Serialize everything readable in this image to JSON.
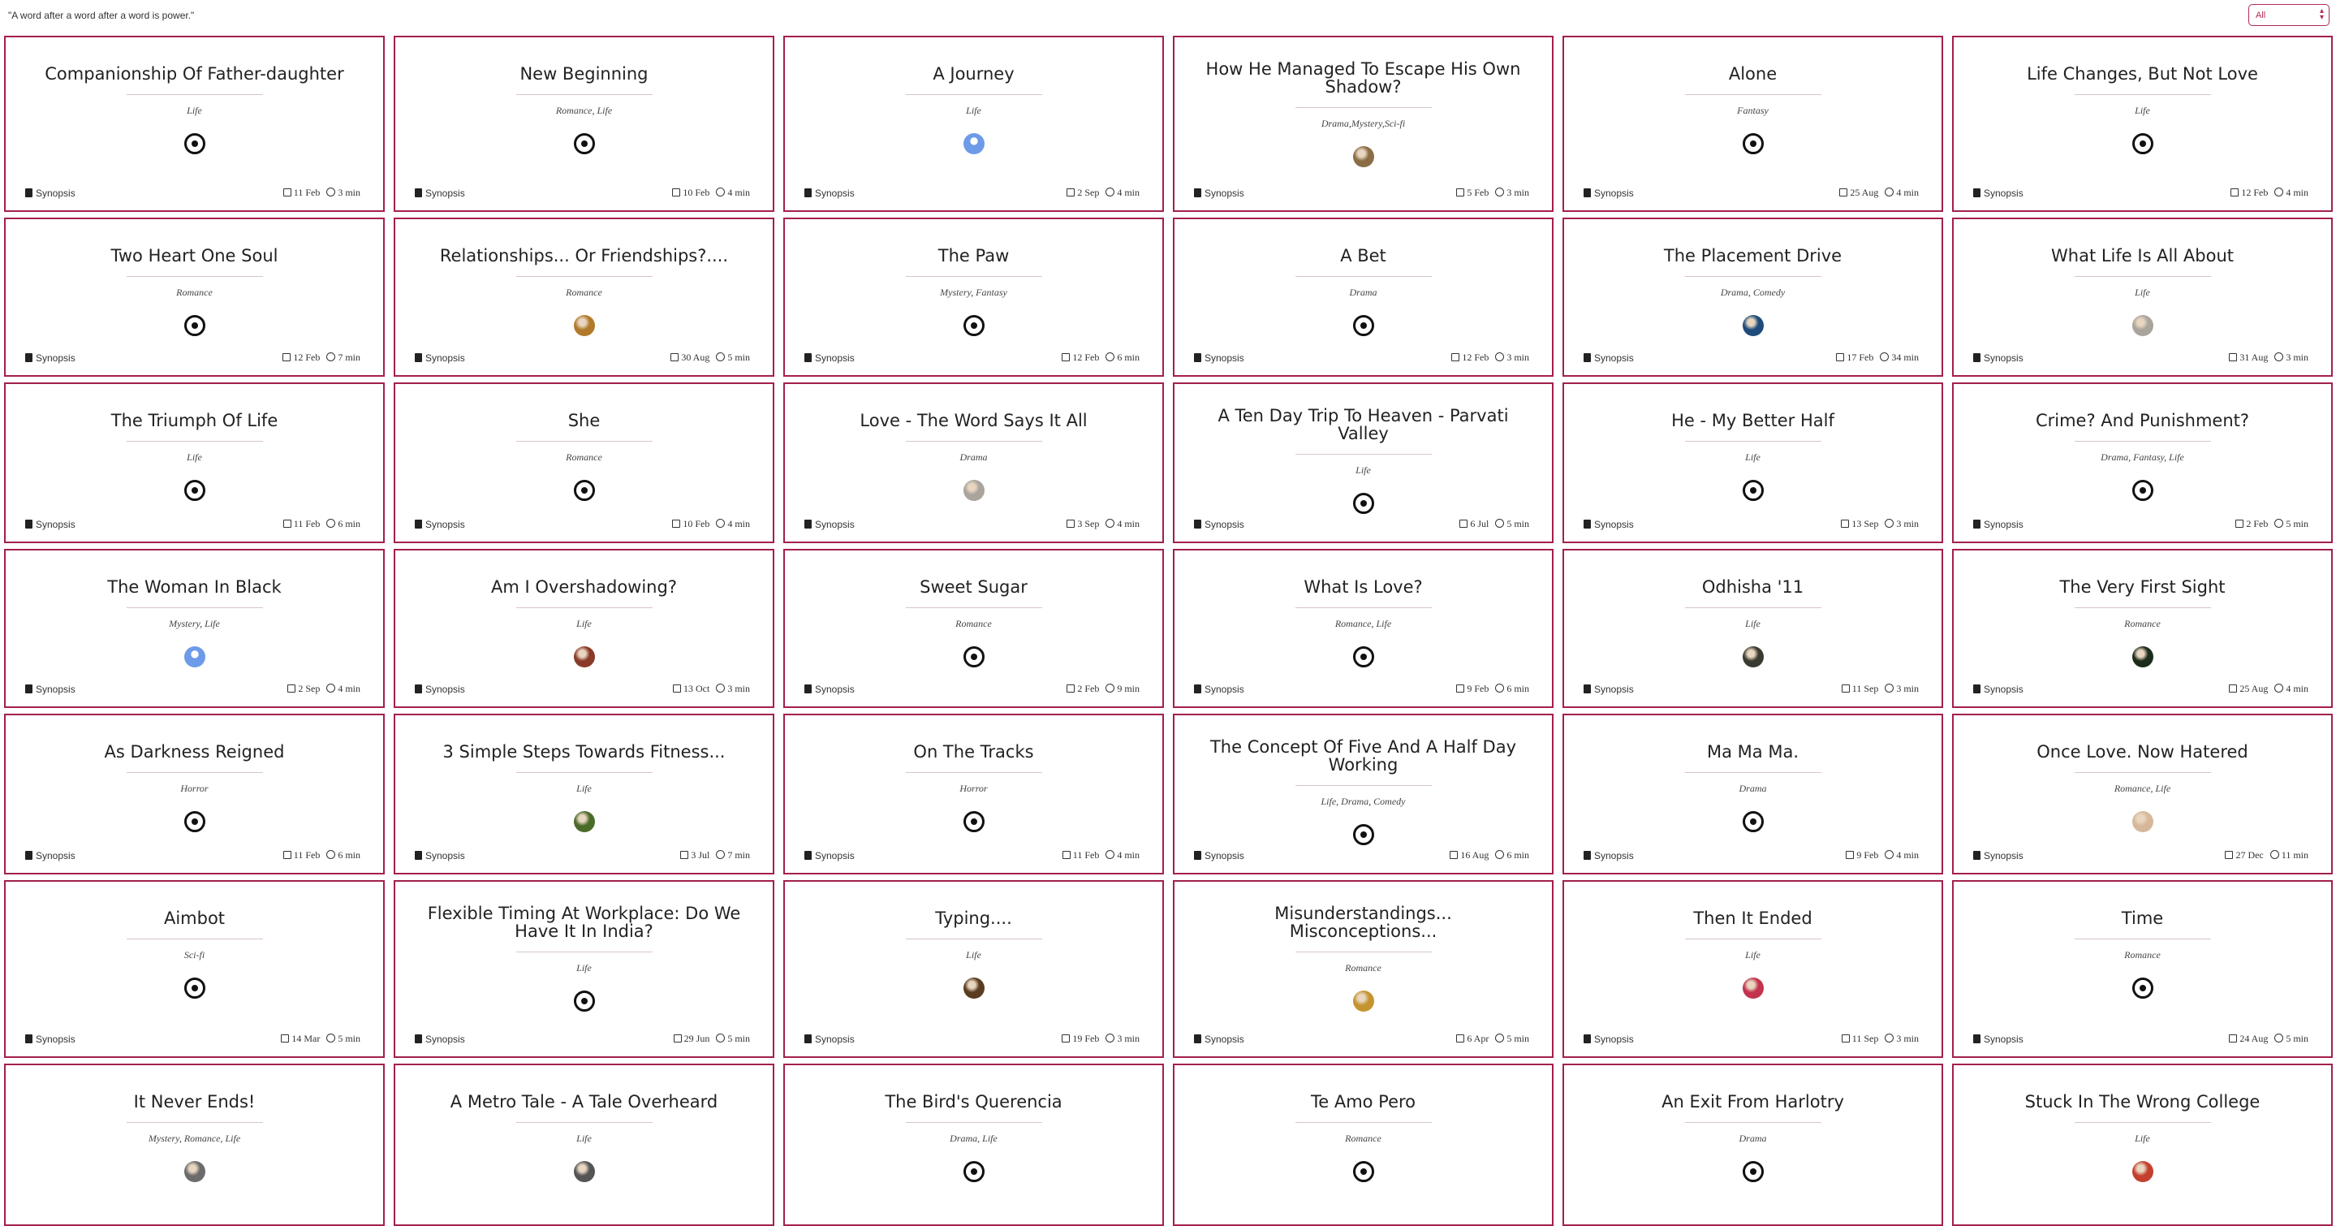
{
  "header": {
    "quote": "\"A word after a word after a word is power.\"",
    "filter": {
      "selected": "All"
    }
  },
  "stories": [
    {
      "title": "Companionship Of Father-daughter",
      "genre": "Life",
      "avatar": "default",
      "date": "11 Feb",
      "read": "3 min"
    },
    {
      "title": "New Beginning",
      "genre": "Romance, Life",
      "avatar": "default",
      "date": "10 Feb",
      "read": "4 min"
    },
    {
      "title": "A Journey",
      "genre": "Life",
      "avatar": "blue",
      "date": "2 Sep",
      "read": "4 min"
    },
    {
      "title": "How He Managed To Escape His Own Shadow?",
      "genre": "Drama,Mystery,Sci-fi",
      "avatar": "#8a6d45",
      "date": "5 Feb",
      "read": "3 min"
    },
    {
      "title": "Alone",
      "genre": "Fantasy",
      "avatar": "default",
      "date": "25 Aug",
      "read": "4 min"
    },
    {
      "title": "Life Changes, But Not Love",
      "genre": "Life",
      "avatar": "default",
      "date": "12 Feb",
      "read": "4 min"
    },
    {
      "title": "Two Heart One Soul",
      "genre": "Romance",
      "avatar": "default",
      "date": "12 Feb",
      "read": "7 min"
    },
    {
      "title": "Relationships... Or Friendships?....",
      "genre": "Romance",
      "avatar": "#b07a2a",
      "date": "30 Aug",
      "read": "5 min"
    },
    {
      "title": "The Paw",
      "genre": "Mystery, Fantasy",
      "avatar": "default",
      "date": "12 Feb",
      "read": "6 min"
    },
    {
      "title": "A Bet",
      "genre": "Drama",
      "avatar": "default",
      "date": "12 Feb",
      "read": "3 min"
    },
    {
      "title": "The Placement Drive",
      "genre": "Drama, Comedy",
      "avatar": "#1f4b7a",
      "date": "17 Feb",
      "read": "34 min"
    },
    {
      "title": "What Life Is All About",
      "genre": "Life",
      "avatar": "#a9a49c",
      "date": "31 Aug",
      "read": "3 min"
    },
    {
      "title": "The Triumph Of Life",
      "genre": "Life",
      "avatar": "default",
      "date": "11 Feb",
      "read": "6 min"
    },
    {
      "title": "She",
      "genre": "Romance",
      "avatar": "default",
      "date": "10 Feb",
      "read": "4 min"
    },
    {
      "title": "Love - The Word Says It All",
      "genre": "Drama",
      "avatar": "#a9a49c",
      "date": "3 Sep",
      "read": "4 min"
    },
    {
      "title": "A Ten Day Trip To Heaven - Parvati Valley",
      "genre": "Life",
      "avatar": "default",
      "date": "6 Jul",
      "read": "5 min"
    },
    {
      "title": "He - My Better Half",
      "genre": "Life",
      "avatar": "default",
      "date": "13 Sep",
      "read": "3 min"
    },
    {
      "title": "Crime? And Punishment?",
      "genre": "Drama, Fantasy, Life",
      "avatar": "default",
      "date": "2 Feb",
      "read": "5 min"
    },
    {
      "title": "The Woman In Black",
      "genre": "Mystery, Life",
      "avatar": "blue",
      "date": "2 Sep",
      "read": "4 min"
    },
    {
      "title": "Am I Overshadowing?",
      "genre": "Life",
      "avatar": "#8a3a28",
      "date": "13 Oct",
      "read": "3 min"
    },
    {
      "title": "Sweet Sugar",
      "genre": "Romance",
      "avatar": "default",
      "date": "2 Feb",
      "read": "9 min"
    },
    {
      "title": "What Is Love?",
      "genre": "Romance, Life",
      "avatar": "default",
      "date": "9 Feb",
      "read": "6 min"
    },
    {
      "title": "Odhisha '11",
      "genre": "Life",
      "avatar": "#3a3a30",
      "date": "11 Sep",
      "read": "3 min"
    },
    {
      "title": "The Very First Sight",
      "genre": "Romance",
      "avatar": "#1c2b1a",
      "date": "25 Aug",
      "read": "4 min"
    },
    {
      "title": "As Darkness Reigned",
      "genre": "Horror",
      "avatar": "default",
      "date": "11 Feb",
      "read": "6 min"
    },
    {
      "title": "3 Simple Steps Towards Fitness...",
      "genre": "Life",
      "avatar": "#4a6b2a",
      "date": "3 Jul",
      "read": "7 min"
    },
    {
      "title": "On The Tracks",
      "genre": "Horror",
      "avatar": "default",
      "date": "11 Feb",
      "read": "4 min"
    },
    {
      "title": "The Concept Of Five And A Half Day Working",
      "genre": "Life, Drama, Comedy",
      "avatar": "default",
      "date": "16 Aug",
      "read": "6 min"
    },
    {
      "title": "Ma Ma Ma.",
      "genre": "Drama",
      "avatar": "default",
      "date": "9 Feb",
      "read": "4 min"
    },
    {
      "title": "Once Love. Now Hatered",
      "genre": "Romance, Life",
      "avatar": "#d7b79a",
      "date": "27 Dec",
      "read": "11 min"
    },
    {
      "title": "Aimbot",
      "genre": "Sci-fi",
      "avatar": "default",
      "date": "14 Mar",
      "read": "5 min"
    },
    {
      "title": "Flexible Timing At Workplace: Do We Have It In India?",
      "genre": "Life",
      "avatar": "default",
      "date": "29 Jun",
      "read": "5 min"
    },
    {
      "title": "Typing....",
      "genre": "Life",
      "avatar": "#5a3c1f",
      "date": "19 Feb",
      "read": "3 min"
    },
    {
      "title": "Misunderstandings... Misconceptions...",
      "genre": "Romance",
      "avatar": "#c4952f",
      "date": "6 Apr",
      "read": "5 min"
    },
    {
      "title": "Then It Ended",
      "genre": "Life",
      "avatar": "#c2334e",
      "date": "11 Sep",
      "read": "3 min"
    },
    {
      "title": "Time",
      "genre": "Romance",
      "avatar": "default",
      "date": "24 Aug",
      "read": "5 min"
    },
    {
      "title": "It Never Ends!",
      "genre": "Mystery, Romance, Life",
      "avatar": "#6b6b6b",
      "date": "",
      "read": ""
    },
    {
      "title": "A Metro Tale - A Tale Overheard",
      "genre": "Life",
      "avatar": "#555555",
      "date": "",
      "read": ""
    },
    {
      "title": "The Bird's Querencia",
      "genre": "Drama, Life",
      "avatar": "default",
      "date": "",
      "read": ""
    },
    {
      "title": "Te Amo Pero",
      "genre": "Romance",
      "avatar": "default",
      "date": "",
      "read": ""
    },
    {
      "title": "An Exit From Harlotry",
      "genre": "Drama",
      "avatar": "default",
      "date": "",
      "read": ""
    },
    {
      "title": "Stuck In The Wrong College",
      "genre": "Life",
      "avatar": "#c4402e",
      "date": "",
      "read": ""
    }
  ],
  "labels": {
    "synopsis": "Synopsis"
  },
  "colors": {
    "accent": "#a3204a"
  }
}
